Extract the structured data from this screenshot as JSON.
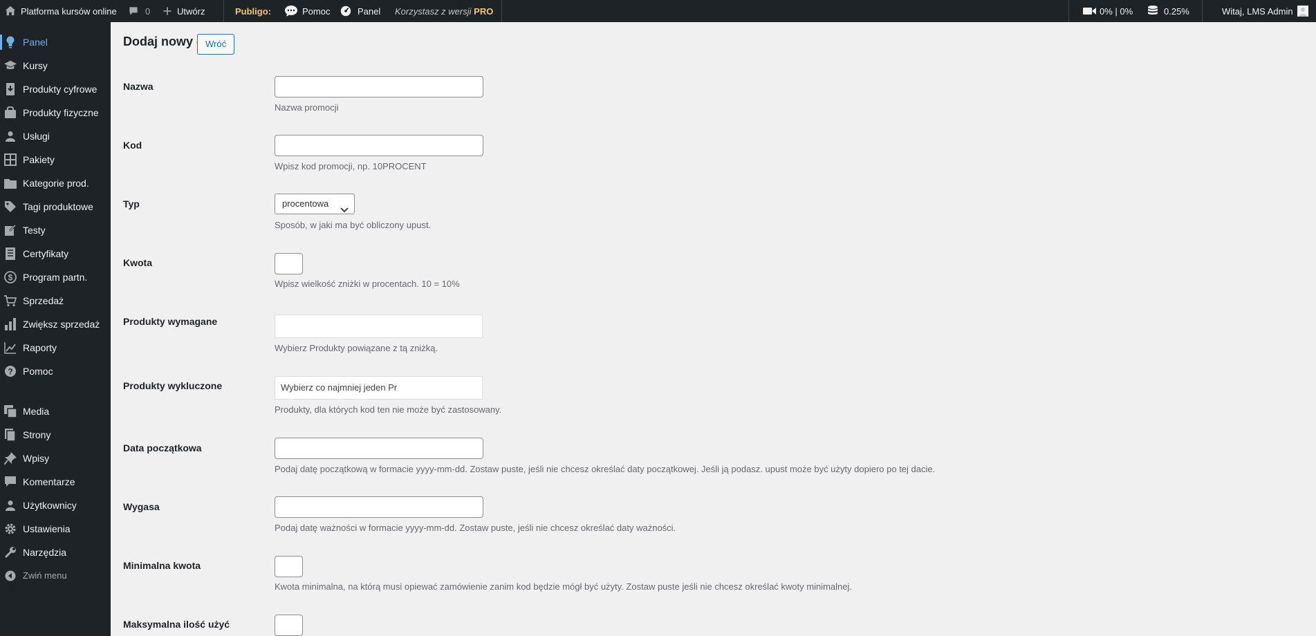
{
  "admin_bar": {
    "site_name": "Platforma kursów online",
    "comments_count": "0",
    "new_label": "Utwórz",
    "brand": "Publigo:",
    "help_label": "Pomoc",
    "panel_label": "Panel",
    "pro_note_prefix": "Korzystasz z wersji",
    "pro_note_badge": "PRO",
    "video_stats": "0% | 0%",
    "storage_stats": "0.25%",
    "greeting": "Witaj, LMS Admin"
  },
  "sidebar": {
    "items": [
      {
        "label": "Panel",
        "icon": "lightbulb-icon",
        "current": true
      },
      {
        "label": "Kursy",
        "icon": "graduation-cap-icon"
      },
      {
        "label": "Produkty cyfrowe",
        "icon": "download-icon"
      },
      {
        "label": "Produkty fizyczne",
        "icon": "shopping-bag-icon"
      },
      {
        "label": "Usługi",
        "icon": "user-service-icon"
      },
      {
        "label": "Pakiety",
        "icon": "grid-icon"
      },
      {
        "label": "Kategorie prod.",
        "icon": "folder-icon"
      },
      {
        "label": "Tagi produktowe",
        "icon": "tag-icon"
      },
      {
        "label": "Testy",
        "icon": "edit-icon"
      },
      {
        "label": "Certyfikaty",
        "icon": "certificate-icon"
      },
      {
        "label": "Program partn.",
        "icon": "dollar-icon"
      },
      {
        "label": "Sprzedaż",
        "icon": "cart-icon"
      },
      {
        "label": "Zwiększ sprzedaż",
        "icon": "bar-chart-icon"
      },
      {
        "label": "Raporty",
        "icon": "line-chart-icon"
      },
      {
        "label": "Pomoc",
        "icon": "help-icon"
      },
      {
        "label": "Media",
        "icon": "media-icon"
      },
      {
        "label": "Strony",
        "icon": "pages-icon"
      },
      {
        "label": "Wpisy",
        "icon": "pin-icon"
      },
      {
        "label": "Komentarze",
        "icon": "comment-icon"
      },
      {
        "label": "Użytkownicy",
        "icon": "users-icon"
      },
      {
        "label": "Ustawienia",
        "icon": "settings-icon"
      },
      {
        "label": "Narzędzia",
        "icon": "wrench-icon"
      },
      {
        "label": "Zwiń menu",
        "icon": "collapse-icon"
      }
    ]
  },
  "page": {
    "title": "Dodaj nowy -",
    "back_label": "Wróć"
  },
  "form": {
    "name": {
      "label": "Nazwa",
      "value": "",
      "desc": "Nazwa promocji"
    },
    "code": {
      "label": "Kod",
      "value": "",
      "desc": "Wpisz kod promocji, np. 10PROCENT"
    },
    "type": {
      "label": "Typ",
      "selected": "procentowa",
      "desc": "Sposób, w jaki ma być obliczony upust."
    },
    "amount": {
      "label": "Kwota",
      "value": "",
      "desc": "Wpisz wielkość zniżki w procentach. 10 = 10%"
    },
    "required_products": {
      "label": "Produkty wymagane",
      "value": "",
      "desc": "Wybierz Produkty powiązane z tą zniżką."
    },
    "excluded_products": {
      "label": "Produkty wykluczone",
      "placeholder": "Wybierz co najmniej jeden Pr",
      "desc": "Produkty, dla których kod ten nie może być zastosowany."
    },
    "start_date": {
      "label": "Data początkowa",
      "value": "",
      "desc": "Podaj datę początkową w formacie yyyy-mm-dd. Zostaw puste, jeśli nie chcesz określać daty początkowej. Jeśli ją podasz. upust może być użyty dopiero po tej dacie."
    },
    "expires": {
      "label": "Wygasa",
      "value": "",
      "desc": "Podaj datę ważności w formacie yyyy-mm-dd. Zostaw puste, jeśli nie chcesz określać daty ważności."
    },
    "min_amount": {
      "label": "Minimalna kwota",
      "value": "",
      "desc": "Kwota minimalna, na którą musi opiewać zamówienie zanim kod będzie mógł być użyty. Zostaw puste jeśli nie chcesz określać kwoty minimalnej."
    },
    "max_uses": {
      "label": "Maksymalna ilość użyć",
      "value": ""
    }
  }
}
